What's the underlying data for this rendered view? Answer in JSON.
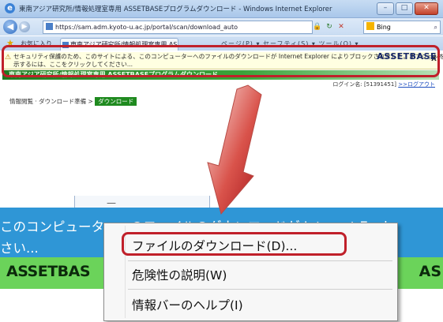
{
  "browser": {
    "window_title": "東南アジア研究所/情報処理室専用  ASSETBASEプログラムダウンロード - Windows Internet Explorer",
    "address": "https://sam.adm.kyoto-u.ac.jp/portal/scan/download_auto",
    "search_placeholder": "Bing",
    "favorites_label": "お気に入り",
    "tab_title": "東南アジア研究所/情報処理室専用  ASSETBAS...",
    "command_bar": "ページ(P) ▾   セーフティ(S) ▾   ツール(O) ▾"
  },
  "infobar": {
    "line1": "セキュリティ保護のため、このサイトによる、このコンピューターへのファイルのダウンロードが Internet Explorer によりブロックされました。オプションを表",
    "line2": "示するには、ここをクリックしてください...",
    "close": "X"
  },
  "site": {
    "header_title": "東南アジア研究所/情報処理室専用   ASSETBASEプログラムダウンロード",
    "logo": "ASSETBASE",
    "login_label": "ログイン名:",
    "login_id": "[51391451]",
    "logout_link": ">>ログアウト"
  },
  "breadcrumb": {
    "path": "情報閲覧 · ダウンロード準備 >",
    "current": "ダウンロード"
  },
  "zoom": {
    "infobar_line1": "このコンピューターへのファイルのダウンロードが Internet Explo",
    "infobar_line2": "さい...",
    "brand": "ASSETBAS",
    "brand_tail": "AS"
  },
  "context_menu": {
    "items": [
      {
        "label": "ファイルのダウンロード(D)..."
      },
      {
        "label": "危険性の説明(W)"
      },
      {
        "label": "情報バーのヘルプ(I)"
      }
    ]
  },
  "colors": {
    "highlight_outline": "#c0202a",
    "info_bar_zoom": "#2f96d6",
    "site_green": "#6bd35a"
  }
}
